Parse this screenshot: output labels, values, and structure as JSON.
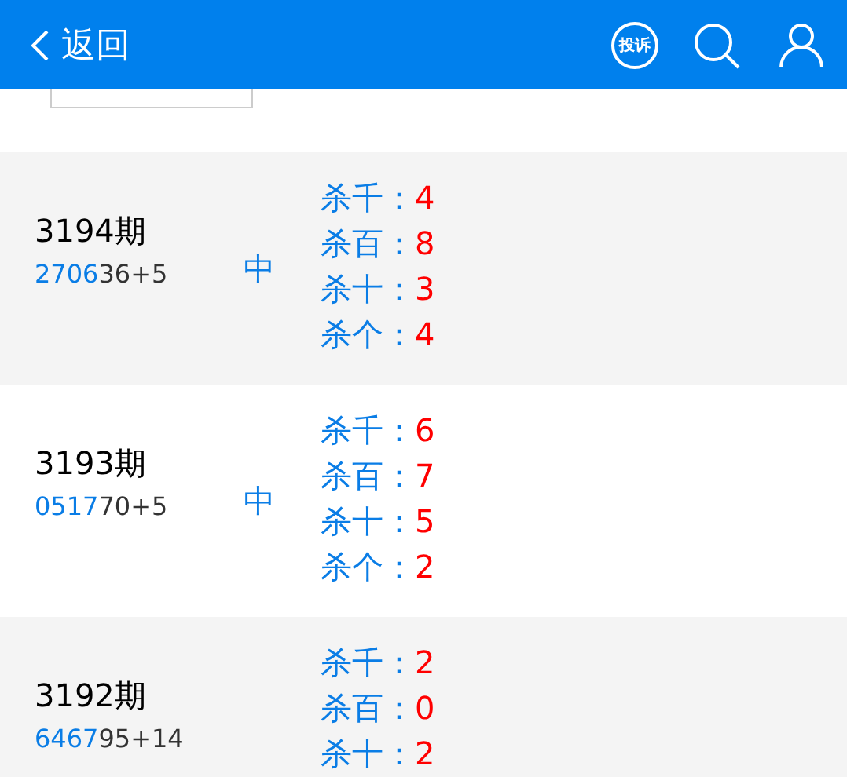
{
  "header": {
    "back_label": "返回",
    "complaint_label": "投诉"
  },
  "rows": [
    {
      "period": "3194期",
      "number_highlight": "2706",
      "number_rest": "36+5",
      "result": "中",
      "kills": [
        {
          "label": "杀千：",
          "value": "4"
        },
        {
          "label": "杀百：",
          "value": "8"
        },
        {
          "label": "杀十：",
          "value": "3"
        },
        {
          "label": "杀个：",
          "value": "4"
        }
      ]
    },
    {
      "period": "3193期",
      "number_highlight": "0517",
      "number_rest": "70+5",
      "result": "中",
      "kills": [
        {
          "label": "杀千：",
          "value": "6"
        },
        {
          "label": "杀百：",
          "value": "7"
        },
        {
          "label": "杀十：",
          "value": "5"
        },
        {
          "label": "杀个：",
          "value": "2"
        }
      ]
    },
    {
      "period": "3192期",
      "number_highlight": "6467",
      "number_rest": "95+14",
      "kills": [
        {
          "label": "杀千：",
          "value": "2"
        },
        {
          "label": "杀百：",
          "value": "0"
        },
        {
          "label": "杀十：",
          "value": "2"
        }
      ]
    }
  ]
}
